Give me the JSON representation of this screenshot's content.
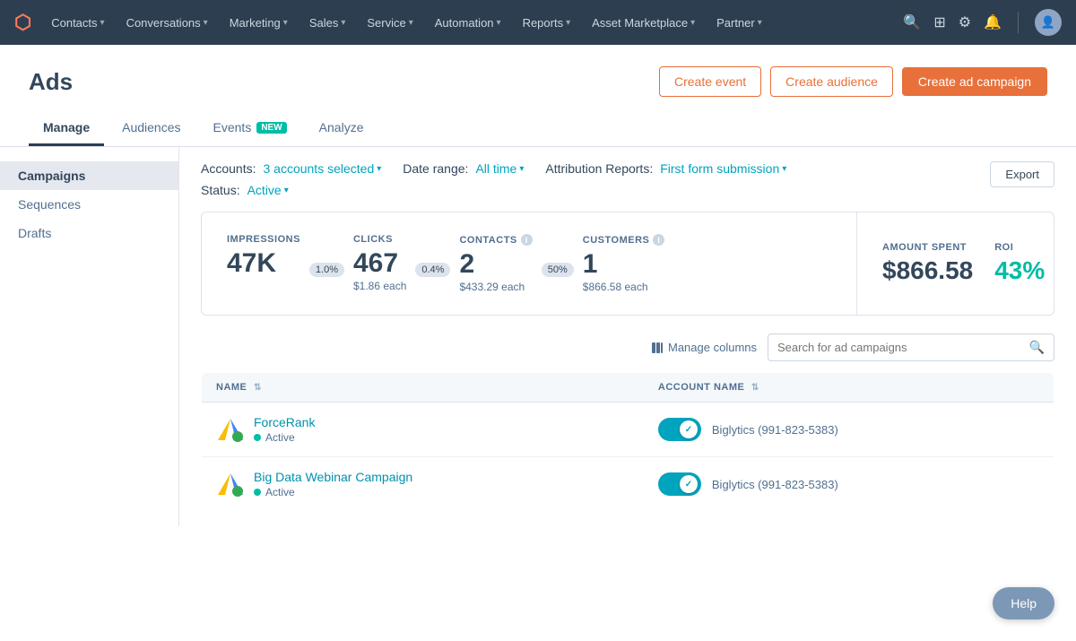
{
  "nav": {
    "logo": "⬡",
    "items": [
      {
        "label": "Contacts",
        "hasChevron": true
      },
      {
        "label": "Conversations",
        "hasChevron": true
      },
      {
        "label": "Marketing",
        "hasChevron": true
      },
      {
        "label": "Sales",
        "hasChevron": true
      },
      {
        "label": "Service",
        "hasChevron": true
      },
      {
        "label": "Automation",
        "hasChevron": true
      },
      {
        "label": "Reports",
        "hasChevron": true
      },
      {
        "label": "Asset Marketplace",
        "hasChevron": true
      },
      {
        "label": "Partner",
        "hasChevron": true
      }
    ]
  },
  "page": {
    "title": "Ads",
    "buttons": {
      "create_event": "Create event",
      "create_audience": "Create audience",
      "create_ad_campaign": "Create ad campaign"
    }
  },
  "tabs": [
    {
      "label": "Manage",
      "active": true,
      "badge": null
    },
    {
      "label": "Audiences",
      "active": false,
      "badge": null
    },
    {
      "label": "Events",
      "active": false,
      "badge": "NEW"
    },
    {
      "label": "Analyze",
      "active": false,
      "badge": null
    }
  ],
  "sidebar": {
    "items": [
      {
        "label": "Campaigns",
        "active": true
      },
      {
        "label": "Sequences",
        "active": false
      },
      {
        "label": "Drafts",
        "active": false
      }
    ]
  },
  "filters": {
    "accounts_label": "Accounts:",
    "accounts_value": "3 accounts selected",
    "date_range_label": "Date range:",
    "date_range_value": "All time",
    "attribution_label": "Attribution Reports:",
    "attribution_value": "First form submission",
    "status_label": "Status:",
    "status_value": "Active",
    "export_label": "Export"
  },
  "stats": {
    "impressions": {
      "label": "IMPRESSIONS",
      "value": "47K",
      "arrow": null
    },
    "clicks": {
      "label": "CLICKS",
      "value": "467",
      "rate": "1.0%",
      "sub": "$1.86 each"
    },
    "contacts": {
      "label": "CONTACTS",
      "value": "2",
      "rate": "0.4%",
      "sub": "$433.29 each",
      "has_info": true
    },
    "customers": {
      "label": "CUSTOMERS",
      "value": "1",
      "rate": "50%",
      "sub": "$866.58 each",
      "has_info": true
    },
    "amount_spent": {
      "label": "AMOUNT SPENT",
      "value": "$866.58"
    },
    "roi": {
      "label": "ROI",
      "value": "43%"
    }
  },
  "table": {
    "manage_columns": "Manage columns",
    "search_placeholder": "Search for ad campaigns",
    "columns": [
      {
        "label": "NAME",
        "sortable": true
      },
      {
        "label": "ACCOUNT NAME",
        "sortable": true
      }
    ],
    "rows": [
      {
        "name": "ForceRank",
        "status": "Active",
        "account": "Biglytics (991-823-5383)"
      },
      {
        "name": "Big Data Webinar Campaign",
        "status": "Active",
        "account": "Biglytics (991-823-5383)"
      }
    ]
  },
  "help": {
    "label": "Help"
  }
}
